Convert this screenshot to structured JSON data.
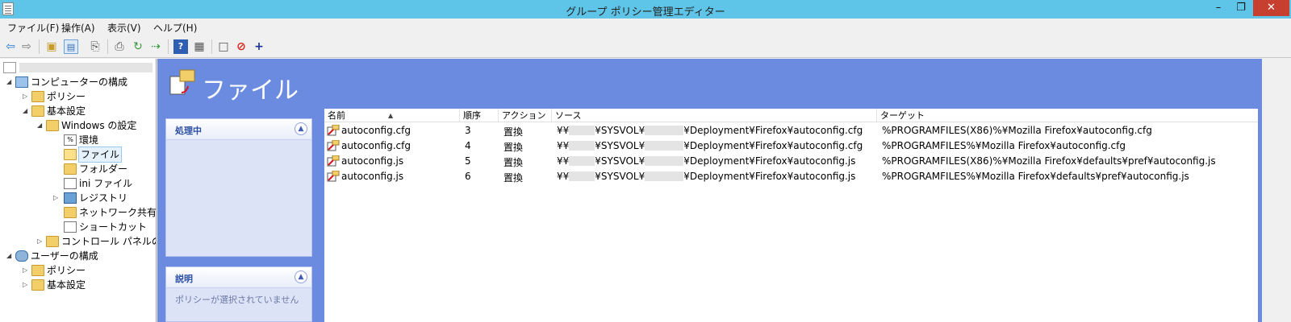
{
  "window": {
    "title": "グループ ポリシー管理エディター",
    "min": "–",
    "max": "❐",
    "close": "✕"
  },
  "menu": [
    {
      "label": "ファイル(F)"
    },
    {
      "label": "操作(A)"
    },
    {
      "label": "表示(V)"
    },
    {
      "label": "ヘルプ(H)"
    }
  ],
  "toolbar": {
    "icons": [
      "back-icon",
      "forward-icon",
      "up-folder-icon",
      "show-hide-tree-icon",
      "export-icon",
      "print-icon",
      "refresh-icon",
      "export-list-icon",
      "help-icon",
      "console-icon",
      "properties-icon",
      "stop-icon",
      "add-icon"
    ]
  },
  "tree": {
    "root_label": "",
    "nodes": [
      {
        "label": "コンピューターの構成"
      },
      {
        "label": "ポリシー"
      },
      {
        "label": "基本設定"
      },
      {
        "label": "Windows の設定"
      },
      {
        "label": "環境"
      },
      {
        "label": "ファイル"
      },
      {
        "label": "フォルダー"
      },
      {
        "label": "ini ファイル"
      },
      {
        "label": "レジストリ"
      },
      {
        "label": "ネットワーク共有"
      },
      {
        "label": "ショートカット"
      },
      {
        "label": "コントロール パネルの設"
      },
      {
        "label": "ユーザーの構成"
      },
      {
        "label": "ポリシー"
      },
      {
        "label": "基本設定"
      }
    ]
  },
  "main": {
    "title": "ファイル",
    "panels": {
      "processing": {
        "title": "処理中"
      },
      "description": {
        "title": "説明",
        "message": "ポリシーが選択されていません"
      }
    },
    "columns": [
      "名前",
      "順序",
      "アクション",
      "ソース",
      "ターゲット"
    ],
    "rows": [
      {
        "name": "autoconfig.cfg",
        "order": "3",
        "action": "置換",
        "src_prefix": "¥¥",
        "src_mid": "¥SYSVOL¥",
        "src_suffix": "¥Deployment¥Firefox¥autoconfig.cfg",
        "target": "%PROGRAMFILES(X86)%¥Mozilla Firefox¥autoconfig.cfg"
      },
      {
        "name": "autoconfig.cfg",
        "order": "4",
        "action": "置換",
        "src_prefix": "¥¥",
        "src_mid": "¥SYSVOL¥",
        "src_suffix": "¥Deployment¥Firefox¥autoconfig.cfg",
        "target": "%PROGRAMFILES%¥Mozilla Firefox¥autoconfig.cfg"
      },
      {
        "name": "autoconfig.js",
        "order": "5",
        "action": "置換",
        "src_prefix": "¥¥",
        "src_mid": "¥SYSVOL¥",
        "src_suffix": "¥Deployment¥Firefox¥autoconfig.js",
        "target": "%PROGRAMFILES(X86)%¥Mozilla Firefox¥defaults¥pref¥autoconfig.js"
      },
      {
        "name": "autoconfig.js",
        "order": "6",
        "action": "置換",
        "src_prefix": "¥¥",
        "src_mid": "¥SYSVOL¥",
        "src_suffix": "¥Deployment¥Firefox¥autoconfig.js",
        "target": "%PROGRAMFILES%¥Mozilla Firefox¥defaults¥pref¥autoconfig.js"
      }
    ]
  },
  "colors": {
    "titlebar": "#5ec5e8",
    "main_bg": "#6a8bdf",
    "close_btn": "#c7402f"
  }
}
